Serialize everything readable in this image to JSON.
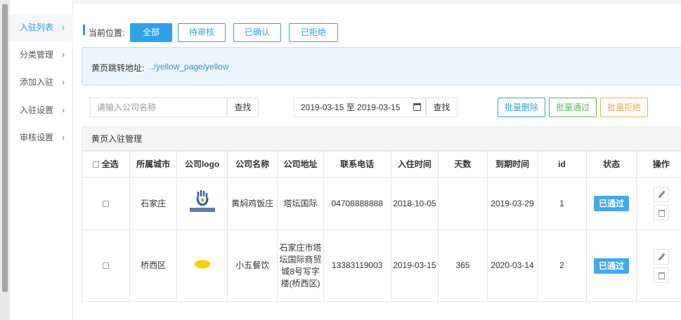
{
  "sidebar": {
    "items": [
      {
        "label": "入驻列表",
        "active": true
      },
      {
        "label": "分类管理",
        "active": false
      },
      {
        "label": "添加入驻",
        "active": false
      },
      {
        "label": "入驻设置",
        "active": false
      },
      {
        "label": "审核设置",
        "active": false
      }
    ],
    "chevron": "›"
  },
  "location": {
    "label": "当前位置:",
    "tabs": [
      "全部",
      "待审核",
      "已确认",
      "已拒绝"
    ],
    "active_tab": "全部"
  },
  "notice": {
    "label": "黄页跳转地址:",
    "url": "../yellow_page/yellow"
  },
  "search": {
    "placeholder": "请输入公司名称",
    "button": "查找",
    "date_range": "2019-03-15 至 2019-03-15",
    "date_button": "查找"
  },
  "bulk": {
    "delete": "批量删除",
    "approve": "批量通过",
    "reject": "批量拒绝"
  },
  "colors": {
    "accent": "#2fa2e9",
    "approve": "#5cb85c",
    "reject": "#f0ad4e",
    "status": "#43a8ef"
  },
  "panel": {
    "title": "黄页入驻管理"
  },
  "table": {
    "select_all": "全选",
    "headers": [
      "所属城市",
      "公司logo",
      "公司名称",
      "公司地址",
      "联系电话",
      "入住时间",
      "天数",
      "到期时间",
      "id",
      "状态",
      "操作"
    ],
    "rows": [
      {
        "city": "石家庄",
        "logo_icon": "hand-logo-icon",
        "name": "黄焖鸡饭庄",
        "address": "塔坛国际",
        "phone": "04708888888",
        "join_date": "2018-10-05",
        "days": "",
        "expire_date": "2019-03-29",
        "id": "1",
        "status": "已通过"
      },
      {
        "city": "桥西区",
        "logo_icon": "yellow-oval-logo-icon",
        "name": "小五餐饮",
        "address": "石家庄市塔坛国际商贸城8号写字楼(桥西区)",
        "phone": "13383119003",
        "join_date": "2019-03-15",
        "days": "365",
        "expire_date": "2020-03-14",
        "id": "2",
        "status": "已通过"
      }
    ]
  }
}
